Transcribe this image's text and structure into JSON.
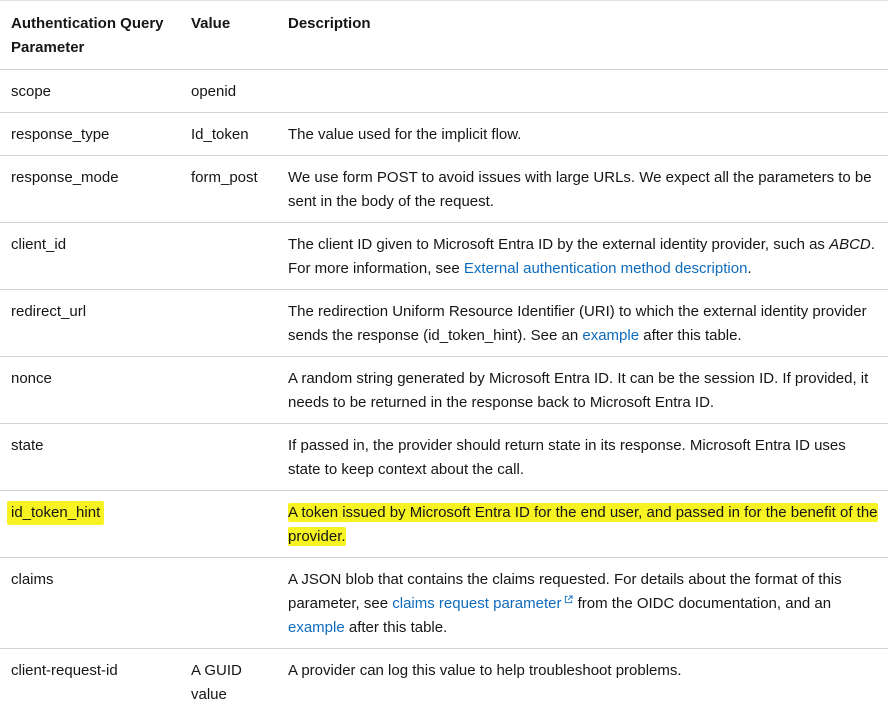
{
  "table": {
    "headers": {
      "param": "Authentication Query Parameter",
      "value": "Value",
      "description": "Description"
    },
    "rows": {
      "scope": {
        "param": "scope",
        "value": "openid",
        "description": ""
      },
      "response_type": {
        "param": "response_type",
        "value": "Id_token",
        "description": "The value used for the implicit flow."
      },
      "response_mode": {
        "param": "response_mode",
        "value": "form_post",
        "description": "We use form POST to avoid issues with large URLs. We expect all the parameters to be sent in the body of the request."
      },
      "client_id": {
        "param": "client_id",
        "value": "",
        "desc_part1": "The client ID given to Microsoft Entra ID by the external identity provider, such as ",
        "desc_em": "ABCD",
        "desc_part2": ". For more information, see ",
        "desc_link": "External authentication method description",
        "desc_part3": "."
      },
      "redirect_url": {
        "param": "redirect_url",
        "value": "",
        "desc_part1": "The redirection Uniform Resource Identifier (URI) to which the external identity provider sends the response (id_token_hint). See an ",
        "desc_link": "example",
        "desc_part2": " after this table."
      },
      "nonce": {
        "param": "nonce",
        "value": "",
        "description": "A random string generated by Microsoft Entra ID. It can be the session ID. If provided, it needs to be returned in the response back to Microsoft Entra ID."
      },
      "state": {
        "param": "state",
        "value": "",
        "description": "If passed in, the provider should return state in its response. Microsoft Entra ID uses state to keep context about the call."
      },
      "id_token_hint": {
        "param": "id_token_hint",
        "value": "",
        "description": "A token issued by Microsoft Entra ID for the end user, and passed in for the benefit of the provider."
      },
      "claims": {
        "param": "claims",
        "value": "",
        "desc_part1": "A JSON blob that contains the claims requested. For details about the format of this parameter, see ",
        "desc_link1": "claims request parameter",
        "desc_part2": " from the OIDC documentation, and an ",
        "desc_link2": "example",
        "desc_part3": " after this table."
      },
      "client_request_id": {
        "param": "client-request-id",
        "value": "A GUID value",
        "description": "A provider can log this value to help troubleshoot problems."
      }
    }
  },
  "colors": {
    "link": "#0f6cbd",
    "highlight": "#f7f322",
    "border": "#d1d1d1",
    "text": "#161616"
  },
  "icons": {
    "external_link": "external-link-icon"
  }
}
